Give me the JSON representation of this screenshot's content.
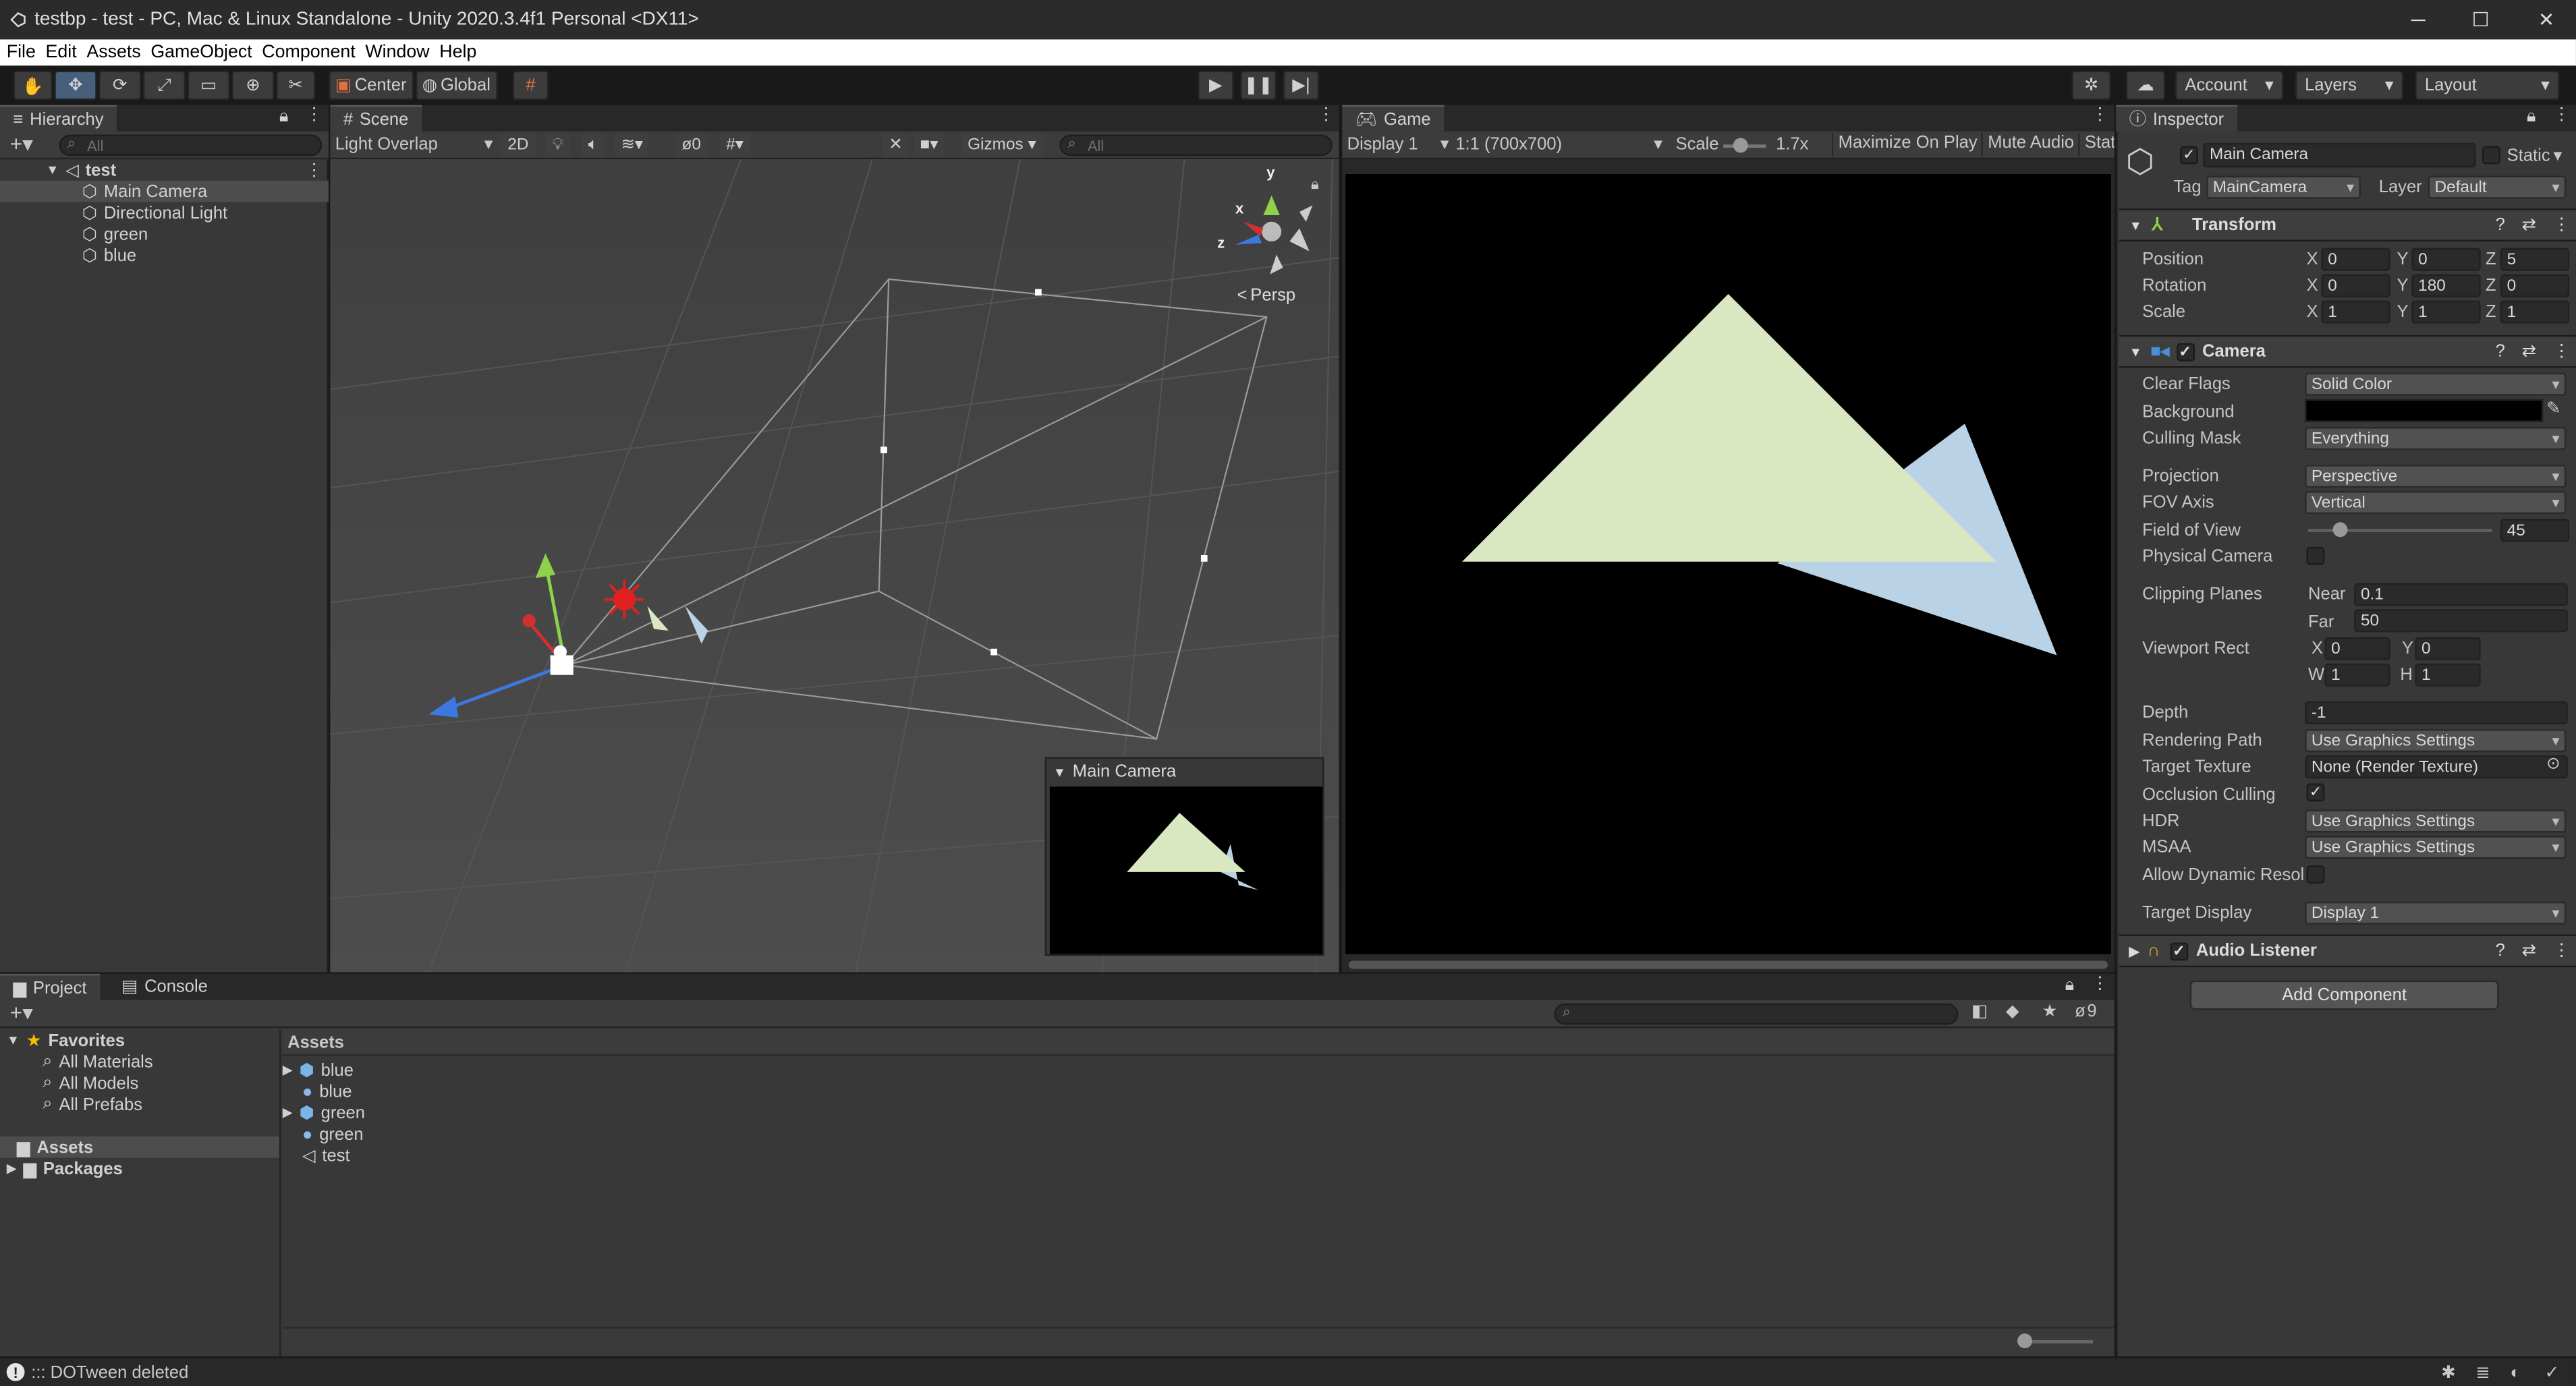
{
  "window": {
    "title": "testbp - test - PC, Mac & Linux Standalone - Unity 2020.3.4f1 Personal <DX11>",
    "minimize": "─",
    "maximize": "☐",
    "close": "✕"
  },
  "menu": [
    "File",
    "Edit",
    "Assets",
    "GameObject",
    "Component",
    "Window",
    "Help"
  ],
  "toolbar": {
    "pivot": "Center",
    "space": "Global",
    "account": "Account",
    "layers": "Layers",
    "layout": "Layout",
    "play_icon": "play-icon",
    "pause_icon": "pause-icon",
    "step_icon": "step-icon"
  },
  "hierarchy": {
    "tab": "Hierarchy",
    "search_placeholder": "All",
    "scene": "test",
    "items": [
      "Main Camera",
      "Directional Light",
      "green",
      "blue"
    ]
  },
  "scene": {
    "tab": "Scene",
    "draw_mode": "Light Overlap",
    "mode2d": "2D",
    "hidden_count": "0",
    "gizmos": "Gizmos",
    "search_placeholder": "All",
    "persp": "Persp",
    "axis_y": "y",
    "axis_x": "x",
    "axis_z": "z",
    "cam_preview_title": "Main Camera"
  },
  "game": {
    "tab": "Game",
    "display": "Display 1",
    "resolution": "1:1 (700x700)",
    "scale_label": "Scale",
    "scale_value": "1.7x",
    "maximize": "Maximize On Play",
    "mute": "Mute Audio",
    "stats": "Stats",
    "colors": {
      "green_tri": "#d9e8c0",
      "blue_tri": "#b9d2e6"
    }
  },
  "inspector": {
    "tab": "Inspector",
    "object_name": "Main Camera",
    "static": "Static",
    "tag_label": "Tag",
    "tag": "MainCamera",
    "layer_label": "Layer",
    "layer": "Default",
    "transform": {
      "title": "Transform",
      "position_label": "Position",
      "rotation_label": "Rotation",
      "scale_label": "Scale",
      "position": {
        "x": "0",
        "y": "0",
        "z": "5"
      },
      "rotation": {
        "x": "0",
        "y": "180",
        "z": "0"
      },
      "scale": {
        "x": "1",
        "y": "1",
        "z": "1"
      }
    },
    "camera": {
      "title": "Camera",
      "clear_flags_label": "Clear Flags",
      "clear_flags": "Solid Color",
      "background_label": "Background",
      "culling_mask_label": "Culling Mask",
      "culling_mask": "Everything",
      "projection_label": "Projection",
      "projection": "Perspective",
      "fov_axis_label": "FOV Axis",
      "fov_axis": "Vertical",
      "fov_label": "Field of View",
      "fov": "45",
      "fov_fraction": 0.17,
      "physical_label": "Physical Camera",
      "clipping_label": "Clipping Planes",
      "near_label": "Near",
      "near": "0.1",
      "far_label": "Far",
      "far": "50",
      "viewport_label": "Viewport Rect",
      "vx": "0",
      "vy": "0",
      "vw": "1",
      "vh": "1",
      "depth_label": "Depth",
      "depth": "-1",
      "rendering_path_label": "Rendering Path",
      "rendering_path": "Use Graphics Settings",
      "target_texture_label": "Target Texture",
      "target_texture": "None (Render Texture)",
      "occlusion_label": "Occlusion Culling",
      "hdr_label": "HDR",
      "hdr": "Use Graphics Settings",
      "msaa_label": "MSAA",
      "msaa": "Use Graphics Settings",
      "dynres_label": "Allow Dynamic Resol",
      "target_display_label": "Target Display",
      "target_display": "Display 1"
    },
    "audio": {
      "title": "Audio Listener"
    },
    "add_component": "Add Component"
  },
  "project": {
    "tab_project": "Project",
    "tab_console": "Console",
    "favorites": "Favorites",
    "fav_items": [
      "All Materials",
      "All Models",
      "All Prefabs"
    ],
    "assets": "Assets",
    "packages": "Packages",
    "assets_header": "Assets",
    "files": [
      {
        "name": "blue",
        "kind": "prefab"
      },
      {
        "name": "blue",
        "kind": "material"
      },
      {
        "name": "green",
        "kind": "prefab"
      },
      {
        "name": "green",
        "kind": "material"
      },
      {
        "name": "test",
        "kind": "scene"
      }
    ],
    "hidden_count": "9"
  },
  "status": {
    "message": "::: DOTween deleted"
  }
}
